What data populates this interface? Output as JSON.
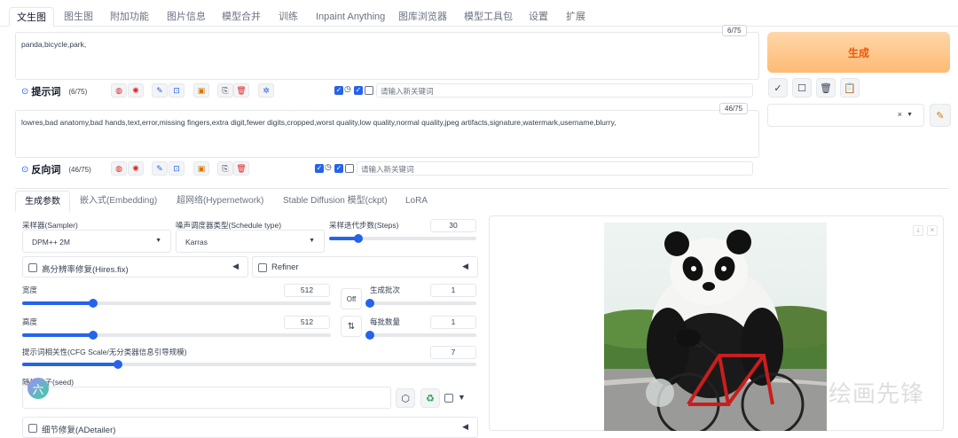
{
  "tabs": [
    "文生图",
    "图生图",
    "附加功能",
    "图片信息",
    "模型合并",
    "训练",
    "Inpaint Anything",
    "图库浏览器",
    "模型工具包",
    "设置",
    "扩展"
  ],
  "prompt": {
    "text": "panda,bicycle,park,",
    "counter": "6/75",
    "label": "提示词",
    "count": "(6/75)",
    "keyword_placeholder": "请输入新关键词"
  },
  "negative": {
    "text": "lowres,bad anatomy,bad hands,text,error,missing fingers,extra digit,fewer digits,cropped,worst quality,low quality,normal quality,jpeg artifacts,signature,watermark,username,blurry,",
    "counter": "46/75",
    "label": "反向词",
    "count": "(46/75)",
    "keyword_placeholder": "请输入新关键词"
  },
  "generate_label": "生成",
  "subtabs": [
    "生成参数",
    "嵌入式(Embedding)",
    "超网络(Hypernetwork)",
    "Stable Diffusion 模型(ckpt)",
    "LoRA"
  ],
  "params": {
    "sampler_label": "采样器(Sampler)",
    "sampler_value": "DPM++ 2M",
    "schedule_label": "噪声调度器类型(Schedule type)",
    "schedule_value": "Karras",
    "steps_label": "采样迭代步数(Steps)",
    "steps_value": "30",
    "steps_fraction": 0.2,
    "hires_label": "高分辨率修复(Hires.fix)",
    "refiner_label": "Refiner",
    "width_label": "宽度",
    "width_value": "512",
    "width_fraction": 0.23,
    "height_label": "高度",
    "height_value": "512",
    "height_fraction": 0.23,
    "off_label": "Off",
    "batch_count_label": "生成批次",
    "batch_count_value": "1",
    "batch_count_fraction": 0.0,
    "batch_size_label": "每批数量",
    "batch_size_value": "1",
    "batch_size_fraction": 0.0,
    "cfg_label": "提示词相关性(CFG Scale/无分类器信息引导规模)",
    "cfg_value": "7",
    "cfg_fraction": 0.21,
    "seed_label": "随机种子(seed)",
    "adetailer_label": "细节修复(ADetailer)"
  },
  "watermark": "绘画先锋",
  "avatar_char": "六",
  "colors": {
    "accent": "#2563eb",
    "generate_start": "#fed7aa",
    "generate_end": "#fdba74",
    "generate_text": "#ea580c"
  }
}
